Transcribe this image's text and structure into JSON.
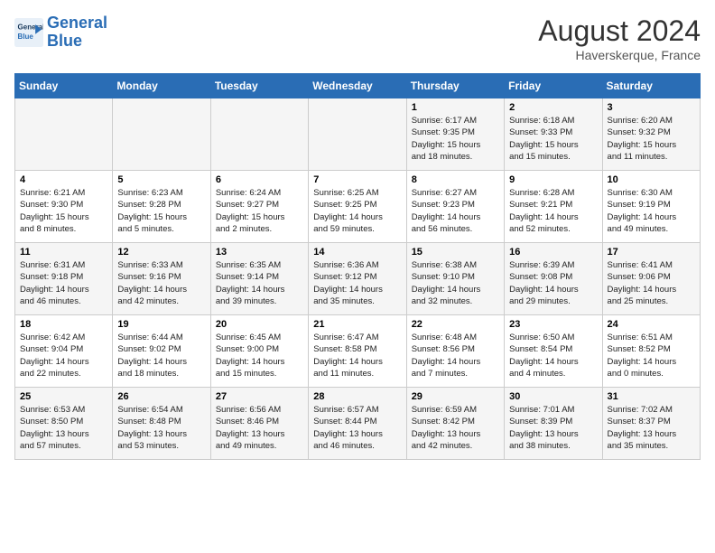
{
  "header": {
    "logo_line1": "General",
    "logo_line2": "Blue",
    "month_year": "August 2024",
    "location": "Haverskerque, France"
  },
  "weekdays": [
    "Sunday",
    "Monday",
    "Tuesday",
    "Wednesday",
    "Thursday",
    "Friday",
    "Saturday"
  ],
  "weeks": [
    [
      {
        "day": "",
        "info": ""
      },
      {
        "day": "",
        "info": ""
      },
      {
        "day": "",
        "info": ""
      },
      {
        "day": "",
        "info": ""
      },
      {
        "day": "1",
        "info": "Sunrise: 6:17 AM\nSunset: 9:35 PM\nDaylight: 15 hours\nand 18 minutes."
      },
      {
        "day": "2",
        "info": "Sunrise: 6:18 AM\nSunset: 9:33 PM\nDaylight: 15 hours\nand 15 minutes."
      },
      {
        "day": "3",
        "info": "Sunrise: 6:20 AM\nSunset: 9:32 PM\nDaylight: 15 hours\nand 11 minutes."
      }
    ],
    [
      {
        "day": "4",
        "info": "Sunrise: 6:21 AM\nSunset: 9:30 PM\nDaylight: 15 hours\nand 8 minutes."
      },
      {
        "day": "5",
        "info": "Sunrise: 6:23 AM\nSunset: 9:28 PM\nDaylight: 15 hours\nand 5 minutes."
      },
      {
        "day": "6",
        "info": "Sunrise: 6:24 AM\nSunset: 9:27 PM\nDaylight: 15 hours\nand 2 minutes."
      },
      {
        "day": "7",
        "info": "Sunrise: 6:25 AM\nSunset: 9:25 PM\nDaylight: 14 hours\nand 59 minutes."
      },
      {
        "day": "8",
        "info": "Sunrise: 6:27 AM\nSunset: 9:23 PM\nDaylight: 14 hours\nand 56 minutes."
      },
      {
        "day": "9",
        "info": "Sunrise: 6:28 AM\nSunset: 9:21 PM\nDaylight: 14 hours\nand 52 minutes."
      },
      {
        "day": "10",
        "info": "Sunrise: 6:30 AM\nSunset: 9:19 PM\nDaylight: 14 hours\nand 49 minutes."
      }
    ],
    [
      {
        "day": "11",
        "info": "Sunrise: 6:31 AM\nSunset: 9:18 PM\nDaylight: 14 hours\nand 46 minutes."
      },
      {
        "day": "12",
        "info": "Sunrise: 6:33 AM\nSunset: 9:16 PM\nDaylight: 14 hours\nand 42 minutes."
      },
      {
        "day": "13",
        "info": "Sunrise: 6:35 AM\nSunset: 9:14 PM\nDaylight: 14 hours\nand 39 minutes."
      },
      {
        "day": "14",
        "info": "Sunrise: 6:36 AM\nSunset: 9:12 PM\nDaylight: 14 hours\nand 35 minutes."
      },
      {
        "day": "15",
        "info": "Sunrise: 6:38 AM\nSunset: 9:10 PM\nDaylight: 14 hours\nand 32 minutes."
      },
      {
        "day": "16",
        "info": "Sunrise: 6:39 AM\nSunset: 9:08 PM\nDaylight: 14 hours\nand 29 minutes."
      },
      {
        "day": "17",
        "info": "Sunrise: 6:41 AM\nSunset: 9:06 PM\nDaylight: 14 hours\nand 25 minutes."
      }
    ],
    [
      {
        "day": "18",
        "info": "Sunrise: 6:42 AM\nSunset: 9:04 PM\nDaylight: 14 hours\nand 22 minutes."
      },
      {
        "day": "19",
        "info": "Sunrise: 6:44 AM\nSunset: 9:02 PM\nDaylight: 14 hours\nand 18 minutes."
      },
      {
        "day": "20",
        "info": "Sunrise: 6:45 AM\nSunset: 9:00 PM\nDaylight: 14 hours\nand 15 minutes."
      },
      {
        "day": "21",
        "info": "Sunrise: 6:47 AM\nSunset: 8:58 PM\nDaylight: 14 hours\nand 11 minutes."
      },
      {
        "day": "22",
        "info": "Sunrise: 6:48 AM\nSunset: 8:56 PM\nDaylight: 14 hours\nand 7 minutes."
      },
      {
        "day": "23",
        "info": "Sunrise: 6:50 AM\nSunset: 8:54 PM\nDaylight: 14 hours\nand 4 minutes."
      },
      {
        "day": "24",
        "info": "Sunrise: 6:51 AM\nSunset: 8:52 PM\nDaylight: 14 hours\nand 0 minutes."
      }
    ],
    [
      {
        "day": "25",
        "info": "Sunrise: 6:53 AM\nSunset: 8:50 PM\nDaylight: 13 hours\nand 57 minutes."
      },
      {
        "day": "26",
        "info": "Sunrise: 6:54 AM\nSunset: 8:48 PM\nDaylight: 13 hours\nand 53 minutes."
      },
      {
        "day": "27",
        "info": "Sunrise: 6:56 AM\nSunset: 8:46 PM\nDaylight: 13 hours\nand 49 minutes."
      },
      {
        "day": "28",
        "info": "Sunrise: 6:57 AM\nSunset: 8:44 PM\nDaylight: 13 hours\nand 46 minutes."
      },
      {
        "day": "29",
        "info": "Sunrise: 6:59 AM\nSunset: 8:42 PM\nDaylight: 13 hours\nand 42 minutes."
      },
      {
        "day": "30",
        "info": "Sunrise: 7:01 AM\nSunset: 8:39 PM\nDaylight: 13 hours\nand 38 minutes."
      },
      {
        "day": "31",
        "info": "Sunrise: 7:02 AM\nSunset: 8:37 PM\nDaylight: 13 hours\nand 35 minutes."
      }
    ]
  ]
}
